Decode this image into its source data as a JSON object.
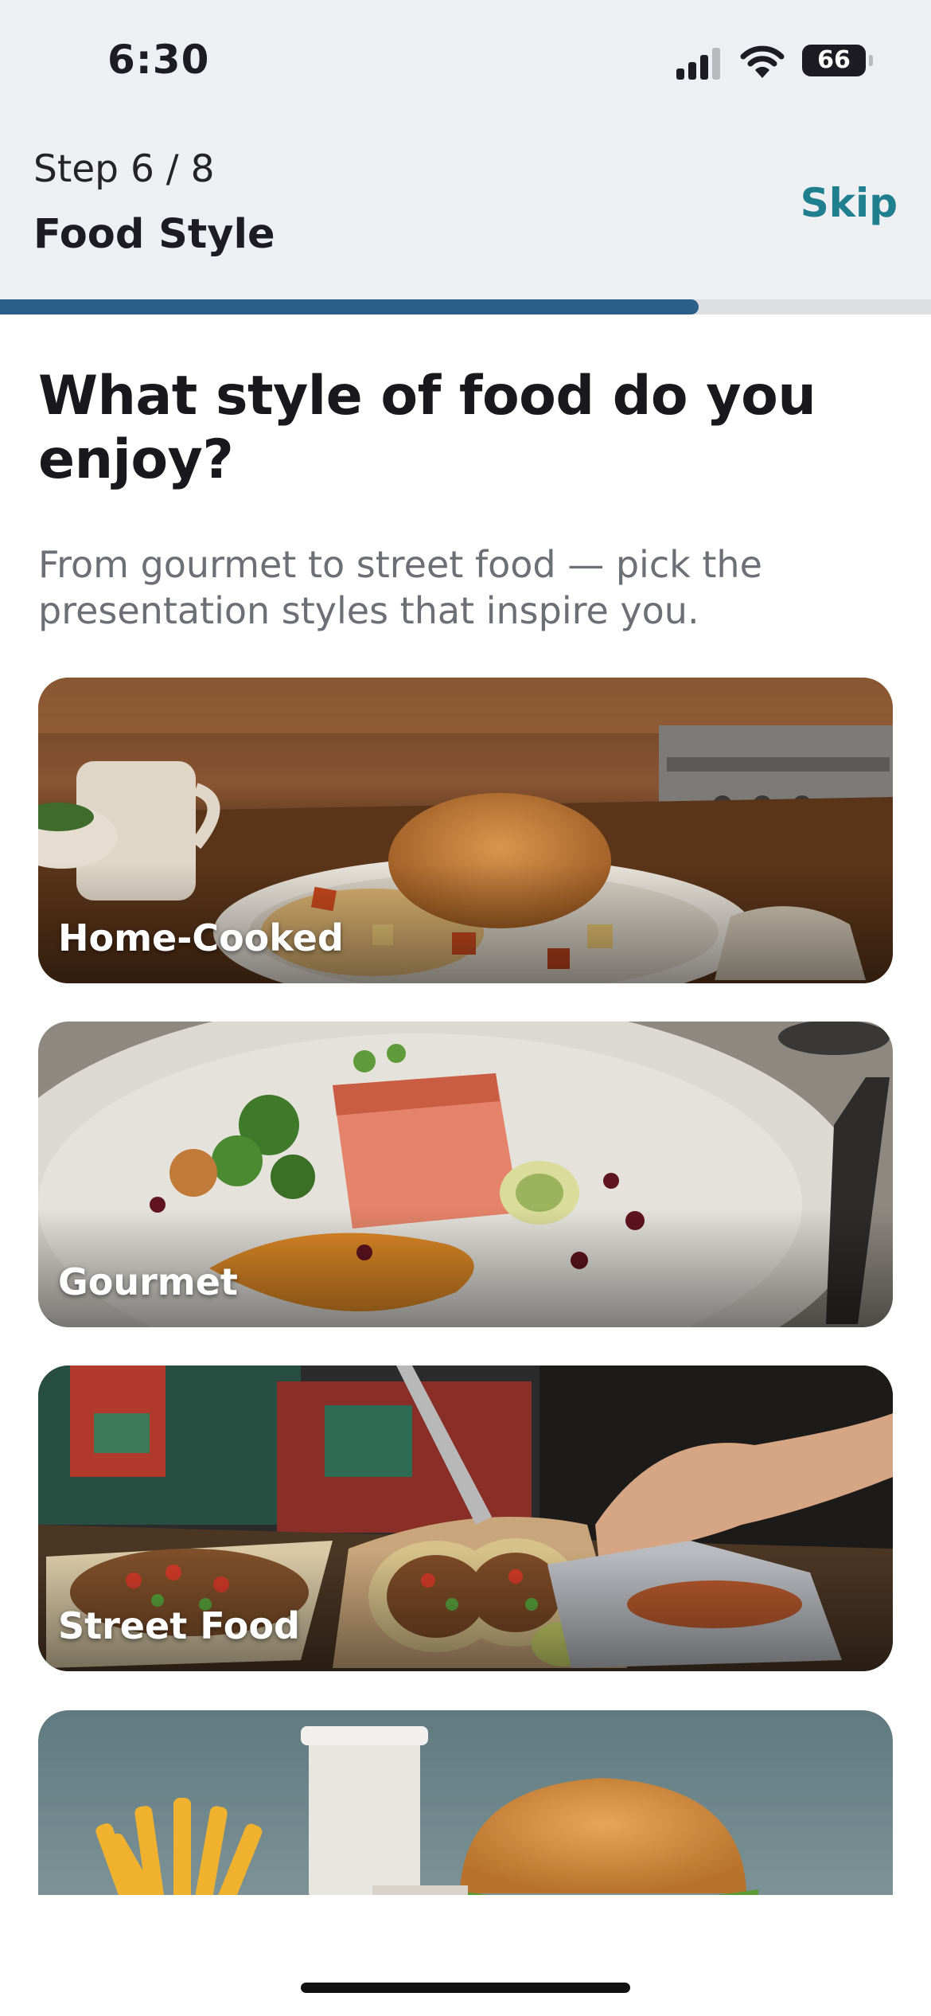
{
  "status_bar": {
    "time": "6:30",
    "battery": "66"
  },
  "header": {
    "step": "Step 6 / 8",
    "title": "Food Style",
    "skip_label": "Skip",
    "progress": 0.75
  },
  "question": {
    "title": "What style of food do you enjoy?",
    "subtitle": "From gourmet to street food — pick the presentation styles that inspire you."
  },
  "options": [
    {
      "label": "Home-Cooked"
    },
    {
      "label": "Gourmet"
    },
    {
      "label": "Street Food"
    },
    {
      "label": ""
    }
  ],
  "colors": {
    "accent": "#1f7f8e",
    "progress": "#2a5f8a",
    "header_bg": "#eeeff2"
  }
}
